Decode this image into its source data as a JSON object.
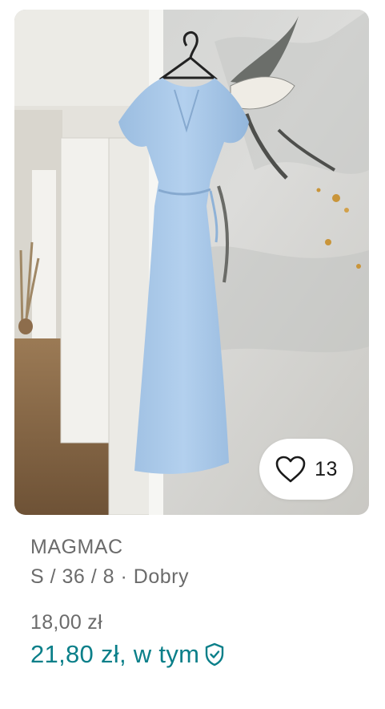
{
  "listing": {
    "favorites_count": "13",
    "brand": "MAGMAC",
    "details": "S / 36 / 8 · Dobry",
    "price": "18,00 zł",
    "price_with_protection": "21,80 zł, w tym"
  },
  "icons": {
    "favorite": "heart-outline-icon",
    "protection": "shield-check-icon"
  },
  "colors": {
    "accent": "#0a7f89",
    "secondary_text": "#6b6b6b",
    "dress": "#a9c9ea"
  }
}
